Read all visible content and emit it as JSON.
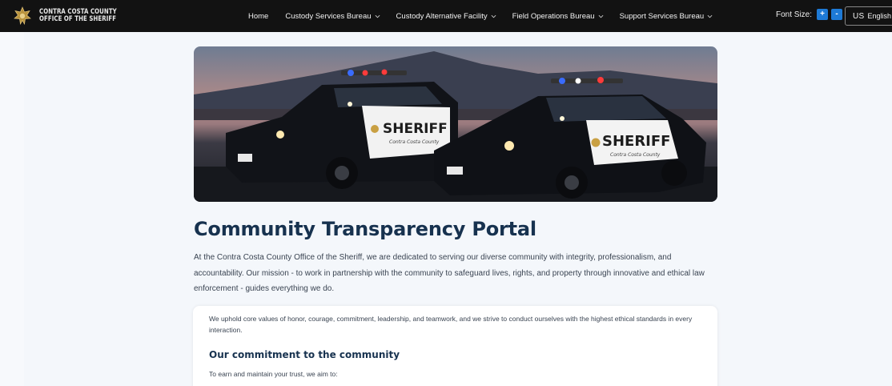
{
  "header": {
    "brand_line1": "CONTRA COSTA COUNTY",
    "brand_line2": "OFFICE OF THE SHERIFF",
    "nav": [
      {
        "label": "Home",
        "dropdown": false
      },
      {
        "label": "Custody Services Bureau",
        "dropdown": true
      },
      {
        "label": "Custody Alternative Facility",
        "dropdown": true
      },
      {
        "label": "Field Operations Bureau",
        "dropdown": true
      },
      {
        "label": "Support Services Bureau",
        "dropdown": true
      }
    ],
    "font_size_label": "Font Size:",
    "increase_label": "+",
    "decrease_label": "-",
    "language_code": "US",
    "language_label": "English"
  },
  "hero": {
    "left_car_text": "SHERIFF",
    "left_car_sub": "Contra Costa County",
    "right_car_text": "SHERIFF",
    "right_car_sub": "Contra Costa County"
  },
  "main": {
    "title": "Community Transparency Portal",
    "intro": "At the Contra Costa County Office of the Sheriff, we are dedicated to serving our diverse community with integrity, professionalism, and accountability. Our mission - to work in partnership with the community to safeguard lives, rights, and property through innovative and ethical law enforcement - guides everything we do.",
    "card": {
      "values_text": "We uphold core values of honor, courage, commitment, leadership, and teamwork, and we strive to conduct ourselves with the highest ethical standards in every interaction.",
      "heading": "Our commitment to the community",
      "subtext": "To earn and maintain your trust, we aim to:"
    }
  },
  "colors": {
    "topbar": "#121212",
    "accent_blue": "#1e7ad6",
    "heading": "#17324f"
  }
}
